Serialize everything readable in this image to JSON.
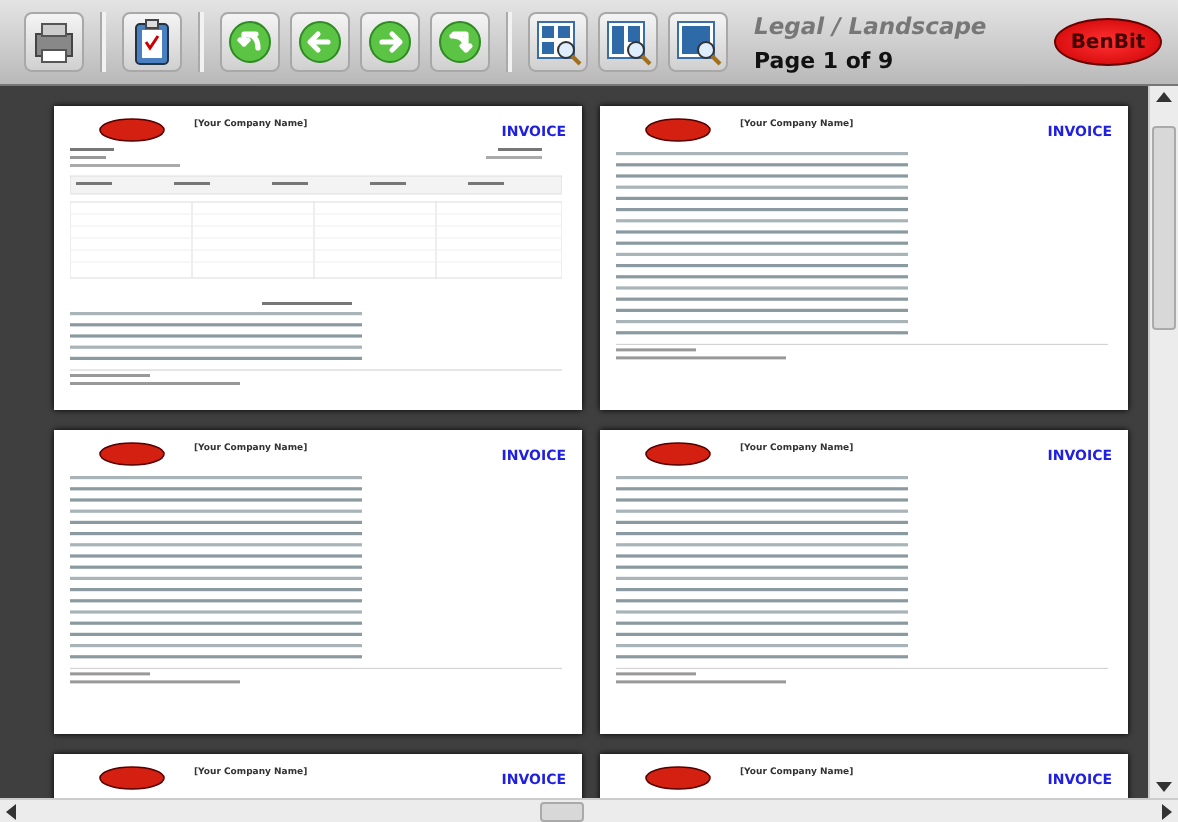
{
  "toolbar": {
    "buttons": [
      {
        "kind": "print"
      },
      {
        "kind": "separator"
      },
      {
        "kind": "report"
      },
      {
        "kind": "separator"
      },
      {
        "kind": "first"
      },
      {
        "kind": "prev"
      },
      {
        "kind": "next"
      },
      {
        "kind": "last"
      },
      {
        "kind": "separator"
      },
      {
        "kind": "zoom-grid"
      },
      {
        "kind": "zoom-two"
      },
      {
        "kind": "zoom-one"
      }
    ],
    "paper": "Legal / Landscape",
    "page_info": "Page 1 of 9",
    "logo": "BenBit"
  },
  "pages": [
    {
      "kind": "table",
      "company": "[Your Company Name]",
      "title": "INVOICE"
    },
    {
      "kind": "text",
      "company": "[Your Company Name]",
      "title": "INVOICE"
    },
    {
      "kind": "text",
      "company": "[Your Company Name]",
      "title": "INVOICE"
    },
    {
      "kind": "text",
      "company": "[Your Company Name]",
      "title": "INVOICE"
    },
    {
      "kind": "header",
      "company": "[Your Company Name]",
      "title": "INVOICE"
    },
    {
      "kind": "header",
      "company": "[Your Company Name]",
      "title": "INVOICE"
    }
  ]
}
